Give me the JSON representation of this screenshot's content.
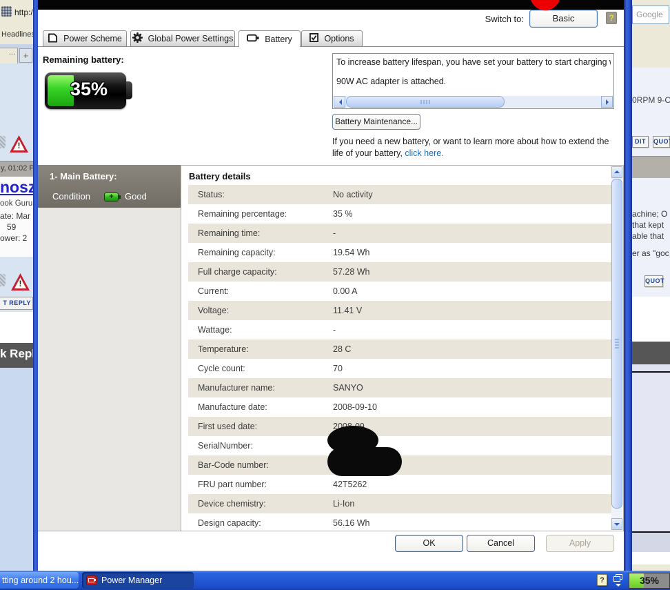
{
  "dialog": {
    "switch_to_label": "Switch to:",
    "basic_button": "Basic",
    "help_icon": "?",
    "tabs": [
      {
        "label": "Power Scheme",
        "icon": "page-icon",
        "active": false
      },
      {
        "label": "Global Power Settings",
        "icon": "gear-icon",
        "active": false
      },
      {
        "label": "Battery",
        "icon": "battery-icon",
        "active": true
      },
      {
        "label": "Options",
        "icon": "checkbox-icon",
        "active": false
      }
    ],
    "remaining_battery_label": "Remaining battery:",
    "battery_percent": "35%",
    "info_box": {
      "line1": "To increase battery lifespan, you have set your battery to start charging wher",
      "line2": "90W AC adapter is attached."
    },
    "battery_maintenance_button": "Battery Maintenance...",
    "help_text": {
      "line1": "If you need a new battery, or want to learn more about how to extend the",
      "line2_prefix": "life of your battery, ",
      "link": "click here."
    },
    "left_panel": {
      "title": "1- Main Battery:",
      "condition_label": "Condition",
      "condition_value": "Good",
      "condition_icon": "green-battery-icon"
    },
    "details": {
      "title": "Battery details",
      "rows": [
        {
          "label": "Status:",
          "value": "No activity"
        },
        {
          "label": "Remaining percentage:",
          "value": "35 %"
        },
        {
          "label": "Remaining time:",
          "value": "-"
        },
        {
          "label": "Remaining capacity:",
          "value": "19.54 Wh"
        },
        {
          "label": "Full charge capacity:",
          "value": "57.28 Wh"
        },
        {
          "label": "Current:",
          "value": "0.00 A"
        },
        {
          "label": "Voltage:",
          "value": "11.41 V"
        },
        {
          "label": "Wattage:",
          "value": "-"
        },
        {
          "label": "Temperature:",
          "value": "28 C"
        },
        {
          "label": "Cycle count:",
          "value": "70"
        },
        {
          "label": "Manufacturer name:",
          "value": "SANYO"
        },
        {
          "label": "Manufacture date:",
          "value": "2008-09-10"
        },
        {
          "label": "First used date:",
          "value": "2008-09"
        },
        {
          "label": "SerialNumber:",
          "value": "",
          "redacted": true
        },
        {
          "label": "Bar-Code number:",
          "value": "",
          "redacted": true
        },
        {
          "label": "FRU part number:",
          "value": "42T5262"
        },
        {
          "label": "Device chemistry:",
          "value": "Li-Ion"
        },
        {
          "label": "Design capacity:",
          "value": "56.16 Wh"
        }
      ]
    },
    "buttons": {
      "ok": "OK",
      "cancel": "Cancel",
      "apply": "Apply"
    }
  },
  "background_left": {
    "url_text": "http:/",
    "headlines": "Headlines",
    "tab_dots": "...",
    "tab_plus": "+",
    "timestamp": "y, 01:02 P",
    "link_big": "nosz",
    "guru": "ook Guru",
    "line1": "ate: Mar",
    "line2": "59",
    "line3": "ower: 2",
    "reply_small": "T REPLY",
    "reply_big": "k Reply",
    "warning_mark": "!"
  },
  "background_right": {
    "google_placeholder": "Google",
    "rpm_text": "0RPM 9-C",
    "btn_edit": "DIT",
    "btn_quote": "QUOT",
    "line1": "achine; O",
    "line2": "that kept",
    "line3": "able that",
    "line4": "er as \"goc",
    "btn_quote2": "QUOT"
  },
  "taskbar": {
    "task1": "tting around 2 hou...",
    "task2": "Power Manager",
    "tray_help": "?",
    "tray_battery": "35%"
  },
  "colors": {
    "window_border_blue": "#2a50c8",
    "taskbar_blue": "#2258d4",
    "row_stripe": "#e9e5da",
    "panel_header_gray": "#7b766e",
    "battery_green": "#35d225",
    "tray_green": "#84e13c",
    "link_blue": "#1a6fb5",
    "redaction_red": "#ee0000",
    "redaction_black": "#0a0a0a"
  }
}
